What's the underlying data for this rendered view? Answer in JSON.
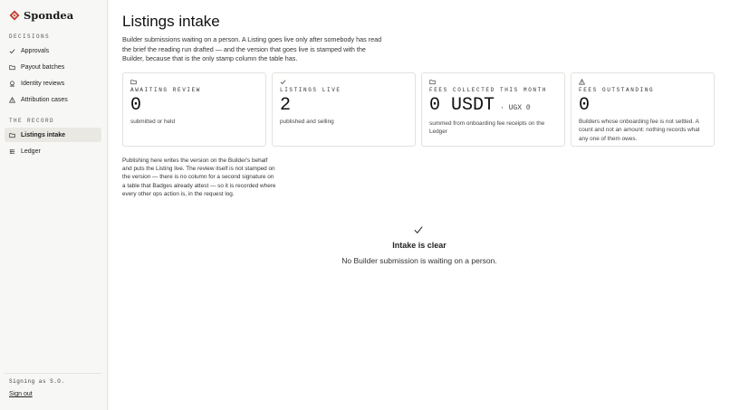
{
  "app": {
    "name": "Spondea",
    "brand_color": "#c0392b"
  },
  "sidebar": {
    "section_decisions": "DECISIONS",
    "decisions": [
      {
        "label": "Approvals",
        "icon": "check-icon"
      },
      {
        "label": "Payout batches",
        "icon": "folder-icon"
      },
      {
        "label": "Identity reviews",
        "icon": "badge-icon"
      },
      {
        "label": "Attribution cases",
        "icon": "warning-icon"
      }
    ],
    "section_record": "THE RECORD",
    "record": [
      {
        "label": "Listings intake",
        "icon": "folder-icon",
        "active": true
      },
      {
        "label": "Ledger",
        "icon": "list-icon"
      }
    ],
    "signing_as": "Signing as S.O.",
    "sign_out": "Sign out"
  },
  "main": {
    "title": "Listings intake",
    "intro": "Builder submissions waiting on a person. A Listing goes live only after somebody has read the brief the reading run drafted — and the version that goes live is stamped with the Builder, because that is the only stamp column the table has.",
    "cards": [
      {
        "label": "AWAITING REVIEW",
        "value": "0",
        "sub": "",
        "note": "submitted or held",
        "icon": "folder-icon"
      },
      {
        "label": "LISTINGS LIVE",
        "value": "2",
        "sub": "",
        "note": "published and selling",
        "icon": "check-icon"
      },
      {
        "label": "FEES COLLECTED THIS MONTH",
        "value": "0 USDT",
        "sub": "· UGX 0",
        "note": "summed from onboarding fee receipts on the Ledger",
        "icon": "folder-icon"
      },
      {
        "label": "FEES OUTSTANDING",
        "value": "0",
        "sub": "",
        "note": "Builders whose onboarding fee is not settled. A count and not an amount: nothing records what any one of them owes.",
        "icon": "warning-icon"
      }
    ],
    "explain": "Publishing here writes the version on the Builder's behalf and puts the Listing live. The review itself is not stamped on the version — there is no column for a second signature on a table that Badges already attest — so it is recorded where every other ops action is, in the request log.",
    "empty": {
      "title": "Intake is clear",
      "subtitle": "No Builder submission is waiting on a person."
    }
  }
}
